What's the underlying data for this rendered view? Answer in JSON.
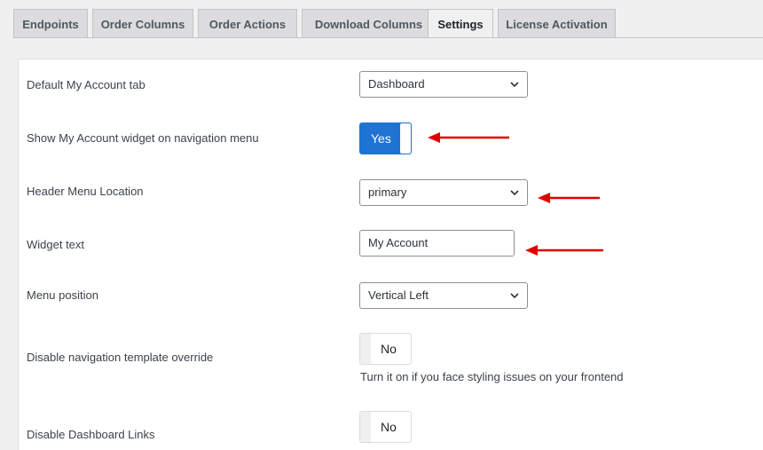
{
  "tabs": [
    {
      "label": "Endpoints",
      "active": false
    },
    {
      "label": "Order Columns",
      "active": false
    },
    {
      "label": "Order Actions",
      "active": false
    },
    {
      "label": "Download Columns",
      "active": false
    },
    {
      "label": "Settings",
      "active": true
    },
    {
      "label": "License Activation",
      "active": false
    }
  ],
  "settings": {
    "default_tab": {
      "label": "Default My Account tab",
      "value": "Dashboard"
    },
    "show_widget": {
      "label": "Show My Account widget on navigation menu",
      "value": "Yes"
    },
    "header_menu_location": {
      "label": "Header Menu Location",
      "value": "primary"
    },
    "widget_text": {
      "label": "Widget text",
      "value": "My Account"
    },
    "menu_position": {
      "label": "Menu position",
      "value": "Vertical Left"
    },
    "disable_nav_override": {
      "label": "Disable navigation template override",
      "value": "No",
      "description": "Turn it on if you face styling issues on your frontend"
    },
    "disable_dashboard_links": {
      "label": "Disable Dashboard Links",
      "value": "No"
    }
  },
  "colors": {
    "toggle_on": "#1e73d3",
    "annotation_arrow": "#e00000"
  },
  "icons": {
    "select_arrow": "chevron-down-icon",
    "annotation": "arrow-left-icon"
  }
}
